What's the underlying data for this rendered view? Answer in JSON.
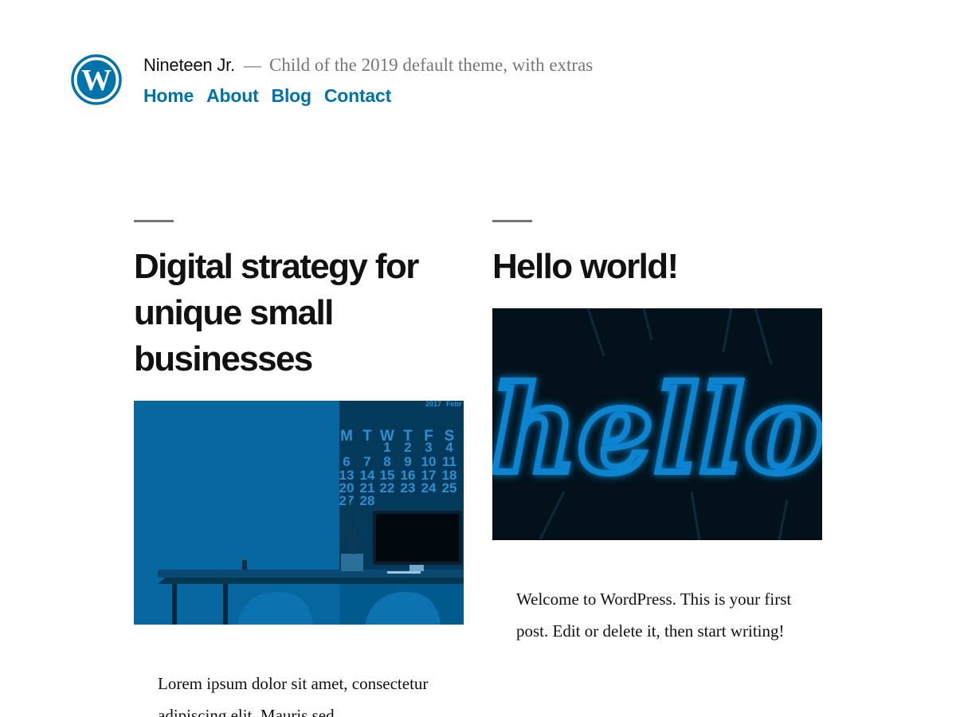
{
  "header": {
    "logo_icon": "wordpress-logo-icon",
    "site_title": "Nineteen Jr.",
    "separator": "—",
    "description": "Child of the 2019 default theme, with extras",
    "nav": [
      {
        "label": "Home"
      },
      {
        "label": "About"
      },
      {
        "label": "Blog"
      },
      {
        "label": "Contact"
      }
    ]
  },
  "posts": [
    {
      "title": "Digital strategy for unique small businesses",
      "image": {
        "icon": "desk-calendar-photo",
        "calendar_header": [
          "2017",
          "Febr"
        ],
        "calendar_days": [
          "M",
          "T",
          "W",
          "T",
          "F",
          "S"
        ],
        "calendar_rows": [
          [
            "",
            "",
            "1",
            "2",
            "3",
            "4"
          ],
          [
            "6",
            "7",
            "8",
            "9",
            "10",
            "11"
          ],
          [
            "13",
            "14",
            "15",
            "16",
            "17",
            "18"
          ],
          [
            "20",
            "21",
            "22",
            "23",
            "24",
            "25"
          ],
          [
            "27",
            "28",
            "",
            "",
            "",
            ""
          ]
        ]
      },
      "excerpt": "Lorem ipsum dolor sit amet, consectetur adipiscing elit. Mauris sed"
    },
    {
      "title": "Hello world!",
      "image": {
        "icon": "neon-hello-sign-photo",
        "neon_text": "hello"
      },
      "excerpt": "Welcome to WordPress. This is your first post. Edit or delete it, then start writing!"
    }
  ],
  "colors": {
    "link": "#0073aa",
    "text": "#111111",
    "muted": "#767676",
    "image_blue": "#005a8e",
    "image_dark": "#03131d",
    "neon": "#0a84d0"
  }
}
